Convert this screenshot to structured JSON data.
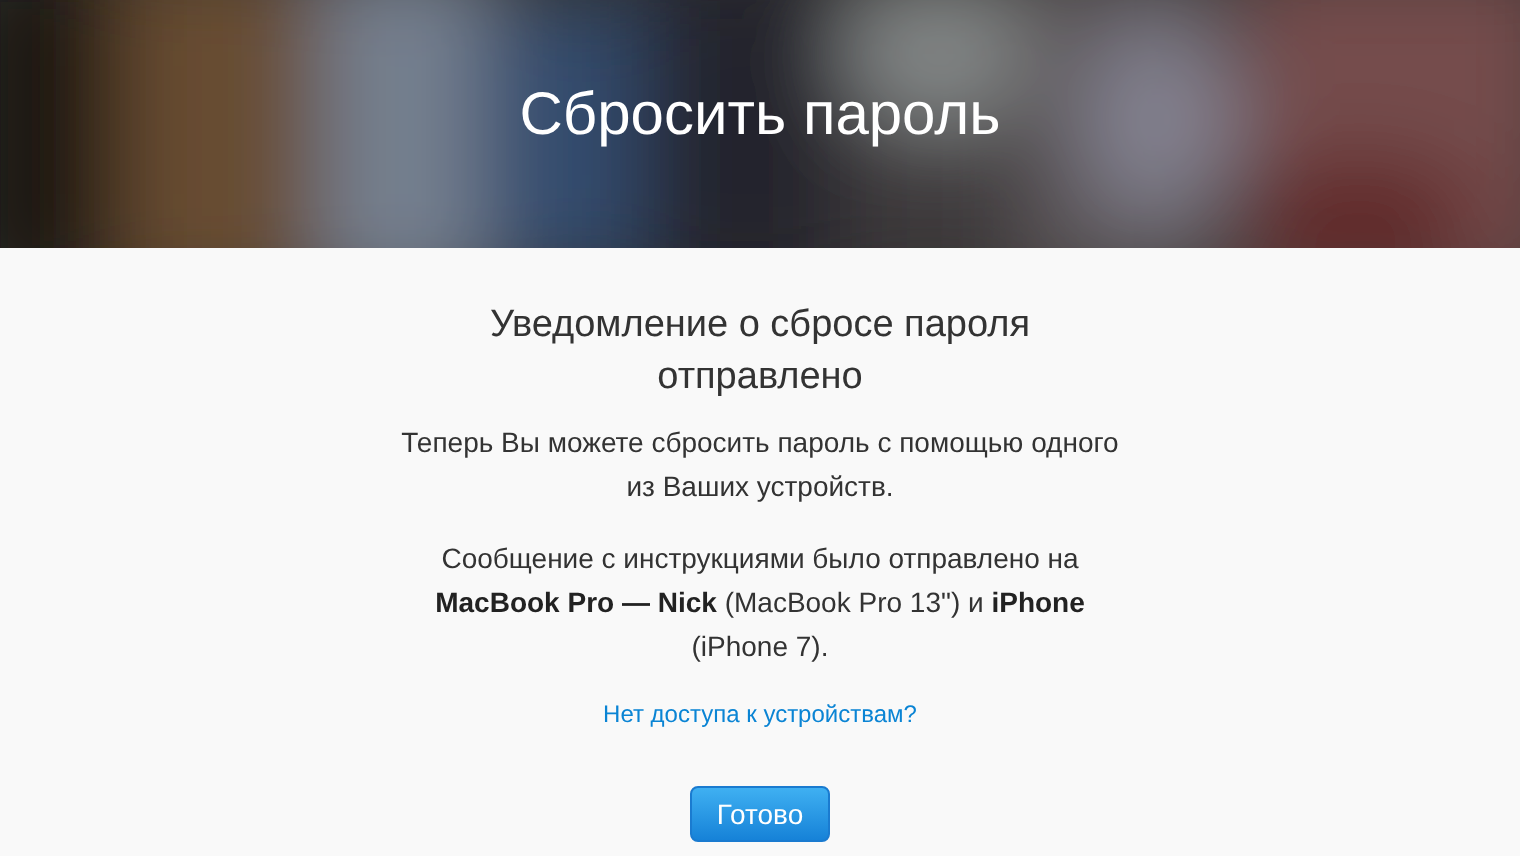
{
  "header": {
    "title": "Сбросить пароль"
  },
  "content": {
    "heading": "Уведомление о сбросе пароля отправлено",
    "paragraphs": [
      "Теперь Вы можете сбросить пароль с помощью одного из Ваших устройств.",
      "Сообщение с инструкциями было отправлено на **MacBook Pro — Nick** (MacBook Pro 13\") и **iPhone** (iPhone 7)."
    ],
    "link": "Нет доступа к устройствам?",
    "button": "Готово"
  }
}
